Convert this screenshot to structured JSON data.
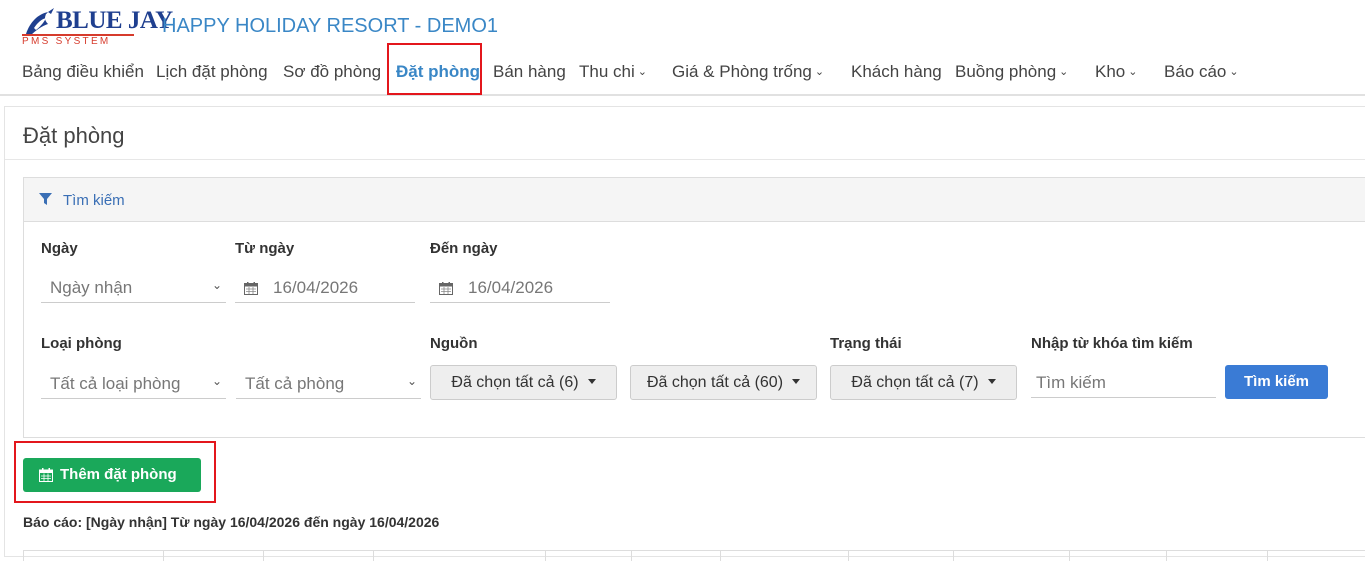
{
  "brand": {
    "name": "BLUE JAY",
    "sub": "PMS SYSTEM"
  },
  "app_title": "HAPPY HOLIDAY RESORT - DEMO1",
  "nav": [
    {
      "label": "Bảng điều khiển",
      "dropdown": false
    },
    {
      "label": "Lịch đặt phòng",
      "dropdown": false
    },
    {
      "label": "Sơ đồ phòng",
      "dropdown": false
    },
    {
      "label": "Đặt phòng",
      "dropdown": false,
      "active": true
    },
    {
      "label": "Bán hàng",
      "dropdown": false
    },
    {
      "label": "Thu chi",
      "dropdown": true
    },
    {
      "label": "Giá & Phòng trống",
      "dropdown": true
    },
    {
      "label": "Khách hàng",
      "dropdown": false
    },
    {
      "label": "Buồng phòng",
      "dropdown": true
    },
    {
      "label": "Kho",
      "dropdown": true
    },
    {
      "label": "Báo cáo",
      "dropdown": true
    }
  ],
  "page_title": "Đặt phòng",
  "search_panel": {
    "title": "Tìm kiếm",
    "date_type": {
      "label": "Ngày",
      "value": "Ngày nhận"
    },
    "from_date": {
      "label": "Từ ngày",
      "value": "16/04/2026"
    },
    "to_date": {
      "label": "Đến ngày",
      "value": "16/04/2026"
    },
    "room_type": {
      "label": "Loại phòng",
      "value": "Tất cả loại phòng"
    },
    "room": {
      "value": "Tất cả phòng"
    },
    "source": {
      "label": "Nguồn",
      "value": "Đã chọn tất cả (6)"
    },
    "source2": {
      "value": "Đã chọn tất cả (60)"
    },
    "status": {
      "label": "Trạng thái",
      "value": "Đã chọn tất cả (7)"
    },
    "keyword": {
      "label": "Nhập từ khóa tìm kiếm",
      "placeholder": "Tìm kiếm"
    },
    "search_button": "Tìm kiếm"
  },
  "add_booking_button": "Thêm đặt phòng",
  "report_text": "Báo cáo: [Ngày nhận] Từ ngày 16/04/2026 đến ngày 16/04/2026",
  "colors": {
    "brand_blue": "#3a87c6",
    "highlight_red": "#e3161c",
    "success_green": "#1aa85a",
    "primary_blue": "#3a7bd5"
  }
}
